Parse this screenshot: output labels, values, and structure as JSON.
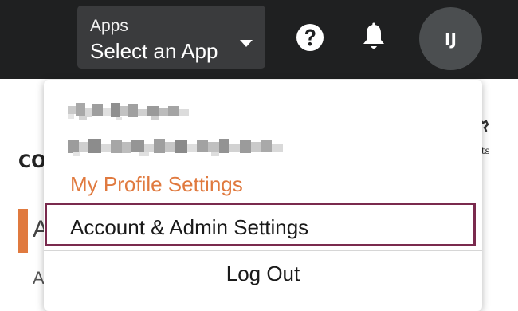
{
  "header": {
    "app_selector": {
      "small_label": "Apps",
      "value": "Select an App"
    },
    "icons": {
      "help": "help-circle-icon",
      "notifications": "bell-icon",
      "caret": "caret-down-icon"
    },
    "avatar": {
      "initials": "IJ"
    }
  },
  "background": {
    "section_heading_partial": "CO",
    "nav_item_1_partial": "A",
    "nav_item_2_partial": "A",
    "right_label_partial": "nts"
  },
  "user_menu": {
    "items": [
      {
        "label": "My Profile Settings",
        "color": "#e07a3f"
      },
      {
        "label": "Account & Admin Settings",
        "highlighted": true
      },
      {
        "label": "Log Out"
      }
    ]
  },
  "colors": {
    "topbar": "#1f2021",
    "accent_orange": "#e07a3f",
    "highlight_border": "#7a2a4e"
  }
}
